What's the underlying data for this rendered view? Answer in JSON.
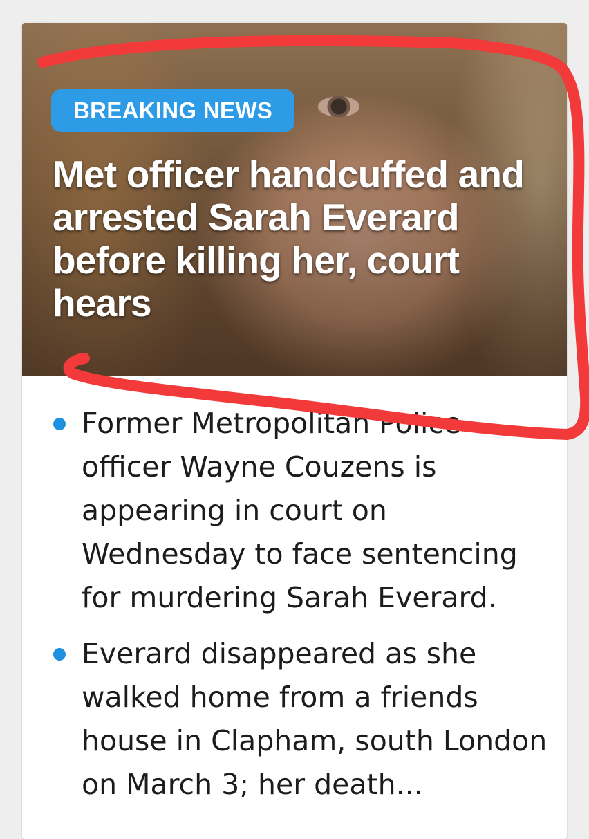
{
  "article": {
    "badge": "BREAKING NEWS",
    "headline": "Met officer handcuffed and arrested Sarah Everard before killing her, court hears",
    "bullets": [
      "Former Metropolitan Police officer Wayne Couzens is appearing in court on Wednesday to face sentencing for murdering Sarah Everard.",
      "Everard disappeared as she walked home from a friends house in Clapham, south London on March 3; her death..."
    ]
  },
  "colors": {
    "badge_background": "#2d9be6",
    "bullet_dot": "#1f8fe0",
    "annotation_stroke": "#f23a3a",
    "card_background": "#ffffff",
    "page_background": "#eeeeee"
  },
  "icons": {
    "bullet": "filled-circle"
  },
  "annotation": {
    "type": "hand-drawn red outline around headline"
  }
}
